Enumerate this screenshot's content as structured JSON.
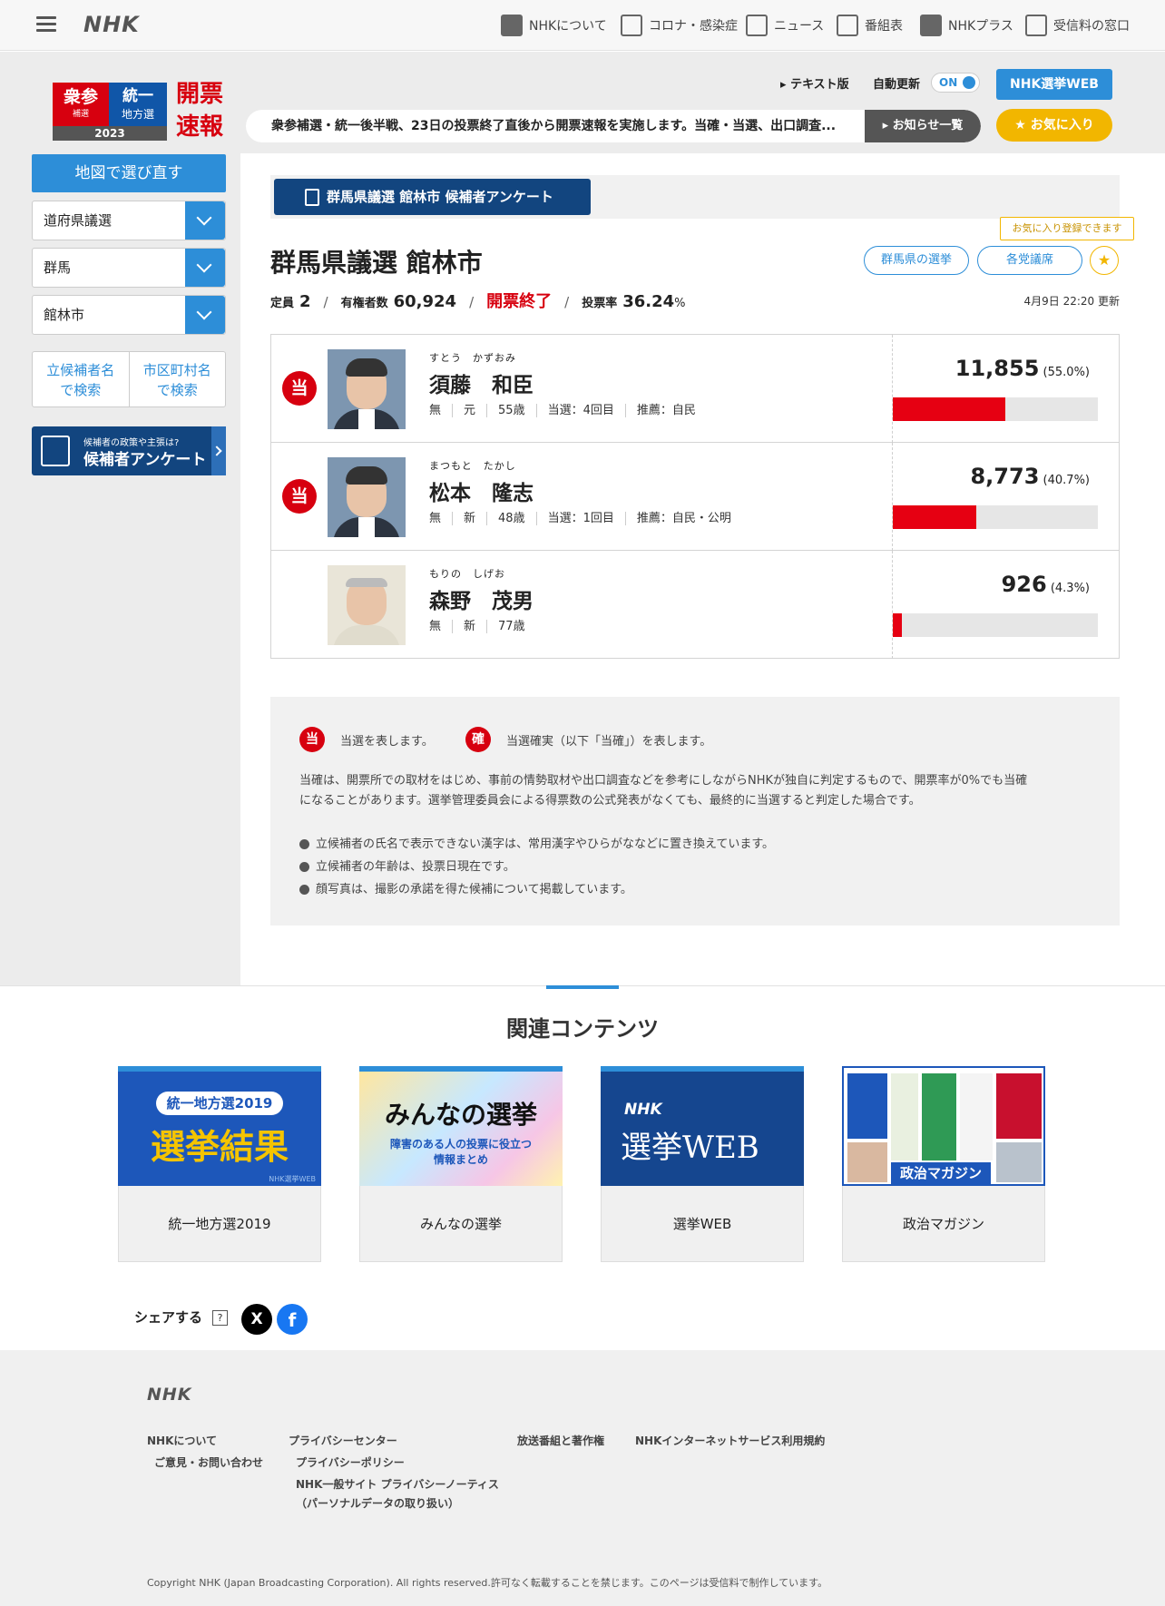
{
  "header": {
    "logo": "NHK",
    "nav": [
      {
        "label": "NHKについて",
        "icon": "nhk-square-icon"
      },
      {
        "label": "コロナ・感染症",
        "icon": "virus-info-icon"
      },
      {
        "label": "ニュース",
        "icon": "news-icon"
      },
      {
        "label": "番組表",
        "icon": "program-grid-icon"
      },
      {
        "label": "NHKプラス",
        "icon": "nhk-plus-icon"
      },
      {
        "label": "受信料の窓口",
        "icon": "tv-receiver-icon"
      }
    ]
  },
  "brand": {
    "red_top": "衆参",
    "red_bottom": "補選",
    "blue_top": "統一",
    "blue_bottom": "地方選",
    "year": "2023",
    "headline_1": "開票",
    "headline_2": "速報"
  },
  "controls": {
    "text_version": "テキスト版",
    "auto_update": "自動更新",
    "toggle_state": "ON",
    "election_web": "NHK選挙WEB",
    "notice": "衆参補選・統一後半戦、23日の投票終了直後から開票速報を実施します。当確・当選、出口調査...",
    "notice_button": "お知らせ一覧",
    "favorite": "お気に入り"
  },
  "sidebar": {
    "map_button": "地図で選び直す",
    "selects": [
      "道府県議選",
      "群馬",
      "館林市"
    ],
    "search_candidate_1": "立候補者名",
    "search_candidate_2": "で検索",
    "search_city_1": "市区町村名",
    "search_city_2": "で検索",
    "survey_small": "候補者の政策や主張は?",
    "survey_big": "候補者アンケート"
  },
  "main": {
    "survey_banner": "群馬県議選 館林市 候補者アンケート",
    "fav_tip": "お気に入り登録できます",
    "title": "群馬県議選 館林市",
    "pill_prefecture": "群馬県の選挙",
    "pill_parties": "各党議席",
    "seats_label": "定員",
    "seats": "2",
    "voters_label": "有権者数",
    "voters": "60,924",
    "status": "開票終了",
    "turnout_label": "投票率",
    "turnout": "36.24",
    "turnout_unit": "%",
    "updated": "4月9日 22:20 更新"
  },
  "candidates": [
    {
      "kana": "すとう　かずおみ",
      "name": "須藤　和臣",
      "badge": "当",
      "party": "無",
      "status": "元",
      "age": "55歳",
      "wins": "当選：4回目",
      "endorse": "推薦：自民",
      "votes": "11,855",
      "pct_text": "(55.0%)",
      "share": 55.0
    },
    {
      "kana": "まつもと　たかし",
      "name": "松本　隆志",
      "badge": "当",
      "party": "無",
      "status": "新",
      "age": "48歳",
      "wins": "当選：1回目",
      "endorse": "推薦：自民・公明",
      "votes": "8,773",
      "pct_text": "(40.7%)",
      "share": 40.7
    },
    {
      "kana": "もりの　しげお",
      "name": "森野　茂男",
      "badge": "",
      "party": "無",
      "status": "新",
      "age": "77歳",
      "wins": "",
      "endorse": "",
      "votes": "926",
      "pct_text": "(4.3%)",
      "share": 4.3
    }
  ],
  "legend": {
    "elected_badge": "当",
    "elected_text": "当選を表します。",
    "certain_badge": "確",
    "certain_text": "当選確実（以下「当確」）を表します。",
    "para_1": "当確は、開票所での取材をはじめ、事前の情勢取材や出口調査などを参考にしながらNHKが独自に判定するもので、開票率が0%でも当確",
    "para_2": "になることがあります。選挙管理委員会による得票数の公式発表がなくても、最終的に当選すると判定した場合です。",
    "notes": [
      "立候補者の氏名で表示できない漢字は、常用漢字やひらがななどに置き換えています。",
      "立候補者の年齢は、投票日現在です。",
      "顔写真は、撮影の承諾を得た候補について掲載しています。"
    ]
  },
  "related": {
    "title": "関連コンテンツ",
    "cards": [
      {
        "caption": "統一地方選2019",
        "thumb_tag": "統一地方選2019",
        "thumb_big": "選挙結果",
        "thumb_mark": "NHK選挙WEB"
      },
      {
        "caption": "みんなの選挙",
        "thumb_big": "みんなの選挙",
        "thumb_sub_1": "障害のある人の投票に役立つ",
        "thumb_sub_2": "情報まとめ"
      },
      {
        "caption": "選挙WEB",
        "thumb_small": "NHK",
        "thumb_big": "選挙WEB"
      },
      {
        "caption": "政治マガジン",
        "thumb_big": "政治マガジン"
      }
    ]
  },
  "share": {
    "label": "シェアする",
    "help": "?",
    "x": "X",
    "facebook": "f"
  },
  "footer": {
    "logo": "NHK",
    "about": "NHKについて",
    "contact": "ご意見・お問い合わせ",
    "privacy_center": "プライバシーセンター",
    "privacy_policy": "プライバシーポリシー",
    "privacy_notice_1": "NHK一般サイト プライバシーノーティス",
    "privacy_notice_2": "（パーソナルデータの取り扱い）",
    "copyright_link": "放送番組と著作権",
    "terms": "NHKインターネットサービス利用規約",
    "copyright": "Copyright NHK (Japan Broadcasting Corporation). All rights reserved.許可なく転載することを禁じます。このページは受信料で制作しています。"
  },
  "colors": {
    "accent_blue": "#2d8ed8",
    "navy": "#12457f",
    "elected_red": "#d7000f",
    "bar_red": "#e60012",
    "favorite_gold": "#f2b600"
  }
}
